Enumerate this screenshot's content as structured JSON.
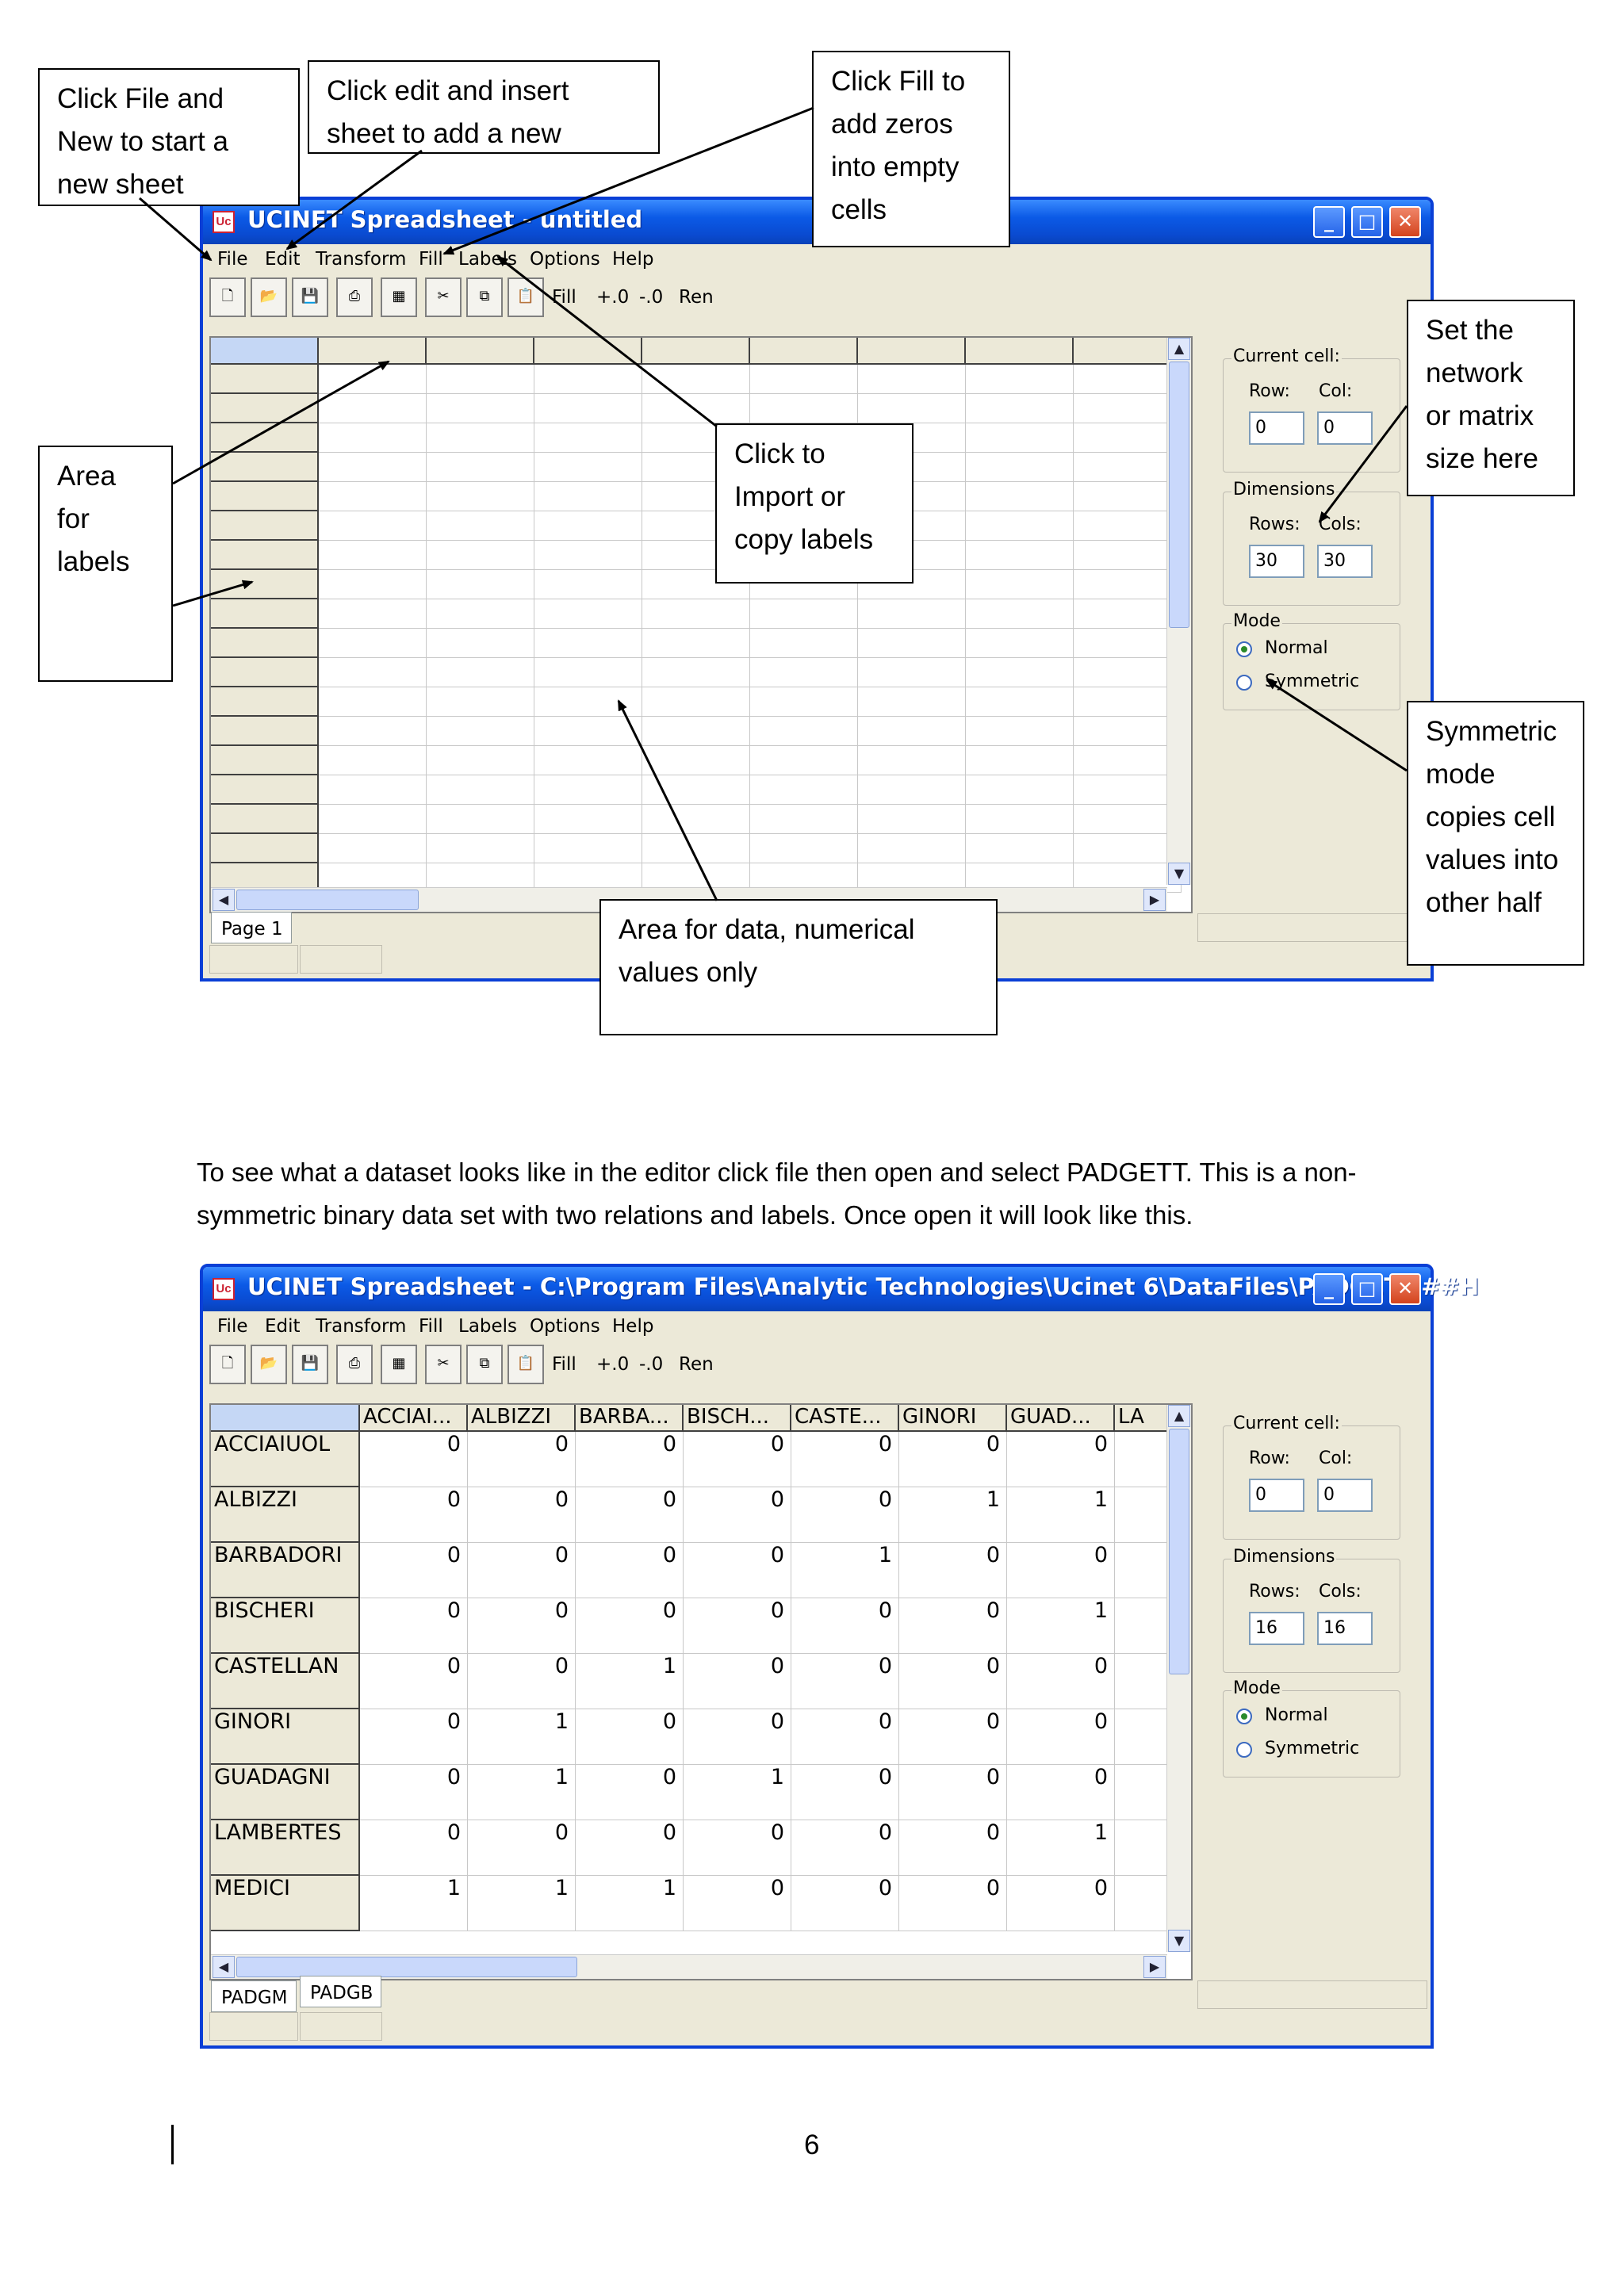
{
  "callouts": {
    "file_new": "Click File and\nNew to start a\nnew sheet",
    "edit_insert": "Click edit and insert\nsheet to add a new",
    "fill": "Click Fill to\nadd zeros\ninto empty\ncells",
    "set_size": "Set the\nnetwork\nor matrix\nsize here",
    "area_labels": "Area\nfor\nlabels",
    "import_labels": "Click to\nImport or\ncopy labels",
    "symmetric": "Symmetric\nmode\ncopies cell\nvalues into\nother half",
    "area_data": "Area for data, numerical\nvalues only"
  },
  "window1": {
    "title": "UCINET Spreadsheet - untitled",
    "sheet_tab": "Page 1",
    "current_cell": {
      "group": "Current cell:",
      "row_label": "Row:",
      "col_label": "Col:",
      "row": "0",
      "col": "0"
    },
    "dimensions": {
      "group": "Dimensions",
      "rows_label": "Rows:",
      "cols_label": "Cols:",
      "rows": "30",
      "cols": "30"
    },
    "mode": {
      "group": "Mode",
      "normal": "Normal",
      "symmetric": "Symmetric",
      "selected": "Normal"
    }
  },
  "window2": {
    "title": "UCINET Spreadsheet - C:\\Program Files\\Analytic Technologies\\Ucinet 6\\DataFiles\\PADGETT.##H",
    "tabs": [
      "PADGM",
      "PADGB"
    ],
    "current_cell": {
      "group": "Current cell:",
      "row_label": "Row:",
      "col_label": "Col:",
      "row": "0",
      "col": "0"
    },
    "dimensions": {
      "group": "Dimensions",
      "rows_label": "Rows:",
      "cols_label": "Cols:",
      "rows": "16",
      "cols": "16"
    },
    "mode": {
      "group": "Mode",
      "normal": "Normal",
      "symmetric": "Symmetric",
      "selected": "Normal"
    },
    "columns": [
      "ACCIAI...",
      "ALBIZZI",
      "BARBA...",
      "BISCH...",
      "CASTE...",
      "GINORI",
      "GUAD...",
      "LA"
    ],
    "rows": [
      {
        "label": "ACCIAIUOL",
        "values": [
          "0",
          "0",
          "0",
          "0",
          "0",
          "0",
          "0"
        ]
      },
      {
        "label": "ALBIZZI",
        "values": [
          "0",
          "0",
          "0",
          "0",
          "0",
          "1",
          "1"
        ]
      },
      {
        "label": "BARBADORI",
        "values": [
          "0",
          "0",
          "0",
          "0",
          "1",
          "0",
          "0"
        ]
      },
      {
        "label": "BISCHERI",
        "values": [
          "0",
          "0",
          "0",
          "0",
          "0",
          "0",
          "1"
        ]
      },
      {
        "label": "CASTELLAN",
        "values": [
          "0",
          "0",
          "1",
          "0",
          "0",
          "0",
          "0"
        ]
      },
      {
        "label": "GINORI",
        "values": [
          "0",
          "1",
          "0",
          "0",
          "0",
          "0",
          "0"
        ]
      },
      {
        "label": "GUADAGNI",
        "values": [
          "0",
          "1",
          "0",
          "1",
          "0",
          "0",
          "0"
        ]
      },
      {
        "label": "LAMBERTES",
        "values": [
          "0",
          "0",
          "0",
          "0",
          "0",
          "0",
          "1"
        ]
      },
      {
        "label": "MEDICI",
        "values": [
          "1",
          "1",
          "1",
          "0",
          "0",
          "0",
          "0"
        ]
      }
    ]
  },
  "menu": [
    "File",
    "Edit",
    "Transform",
    "Fill",
    "Labels",
    "Options",
    "Help"
  ],
  "toolbar": {
    "fill": "Fill",
    "plus": "+.0",
    "minus": "-.0",
    "ren": "Ren"
  },
  "paragraph": "To see what a dataset looks like in the editor click file then open and select PADGETT. This is a non-symmetric binary data set with two relations and labels.  Once open it will look like this.",
  "page_number": "6"
}
